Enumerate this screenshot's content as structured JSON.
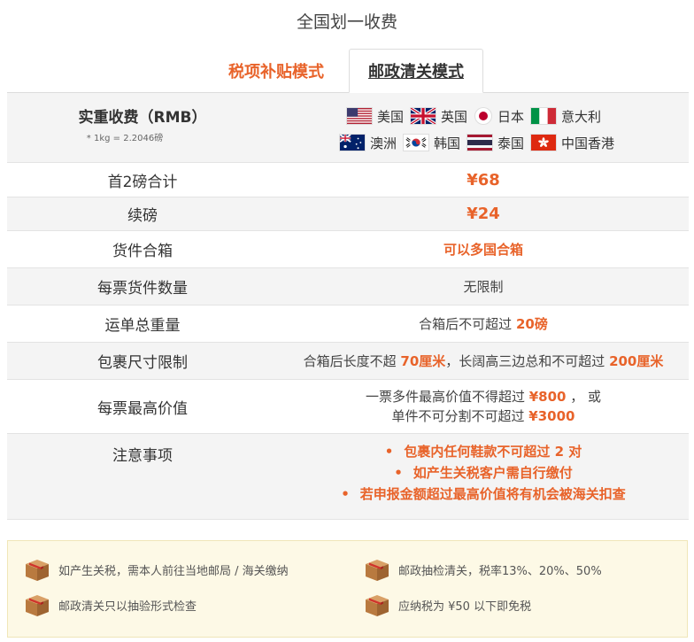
{
  "page_title": "全国划一收费",
  "tabs": [
    {
      "label": "税项补贴模式"
    },
    {
      "label": "邮政清关模式"
    }
  ],
  "header": {
    "label": "实重收费（RMB）",
    "note": "* 1kg = 2.2046磅",
    "countries": [
      {
        "name": "美国",
        "icon": "us-flag-icon"
      },
      {
        "name": "英国",
        "icon": "uk-flag-icon"
      },
      {
        "name": "日本",
        "icon": "japan-flag-icon"
      },
      {
        "name": "意大利",
        "icon": "italy-flag-icon"
      },
      {
        "name": "澳洲",
        "icon": "australia-flag-icon"
      },
      {
        "name": "韩国",
        "icon": "korea-flag-icon"
      },
      {
        "name": "泰国",
        "icon": "thailand-flag-icon"
      },
      {
        "name": "中国香港",
        "icon": "hongkong-flag-icon"
      }
    ]
  },
  "rows": {
    "first2": {
      "label": "首2磅合计",
      "value": "¥68"
    },
    "additional": {
      "label": "续磅",
      "value": "¥24"
    },
    "combine": {
      "label": "货件合箱",
      "value": "可以多国合箱"
    },
    "count": {
      "label": "每票货件数量",
      "value": "无限制"
    },
    "weight": {
      "label": "运单总重量",
      "prefix": "合箱后不可超过 ",
      "highlight": "20磅"
    },
    "size": {
      "label": "包裹尺寸限制",
      "p1": "合箱后长度不超 ",
      "h1": "70厘米",
      "p2": "，长阔高三边总和不可超过 ",
      "h2": "200厘米"
    },
    "value": {
      "label": "每票最高价值",
      "l1_prefix": "一票多件最高价值不得超过 ",
      "l1_h": "¥800",
      "l1_suffix": " ， 或",
      "l2_prefix": "单件不可分割不可超过 ",
      "l2_h": "¥3000"
    },
    "notes": {
      "label": "注意事项",
      "items": [
        "包裹内任何鞋款不可超过 2 对",
        "如产生关税客户需自行缴付",
        "若申报金额超过最高价值将有机会被海关扣查"
      ]
    }
  },
  "info": [
    "如产生关税，需本人前往当地邮局 / 海关缴纳",
    "邮政抽检清关，税率13%、20%、50%",
    "邮政清关只以抽验形式检查",
    "应纳税为 ¥50 以下即免税"
  ],
  "colors": {
    "accent": "#e8632a",
    "row_grey": "#f4f4f4",
    "info_bg": "#fdf9e6"
  }
}
